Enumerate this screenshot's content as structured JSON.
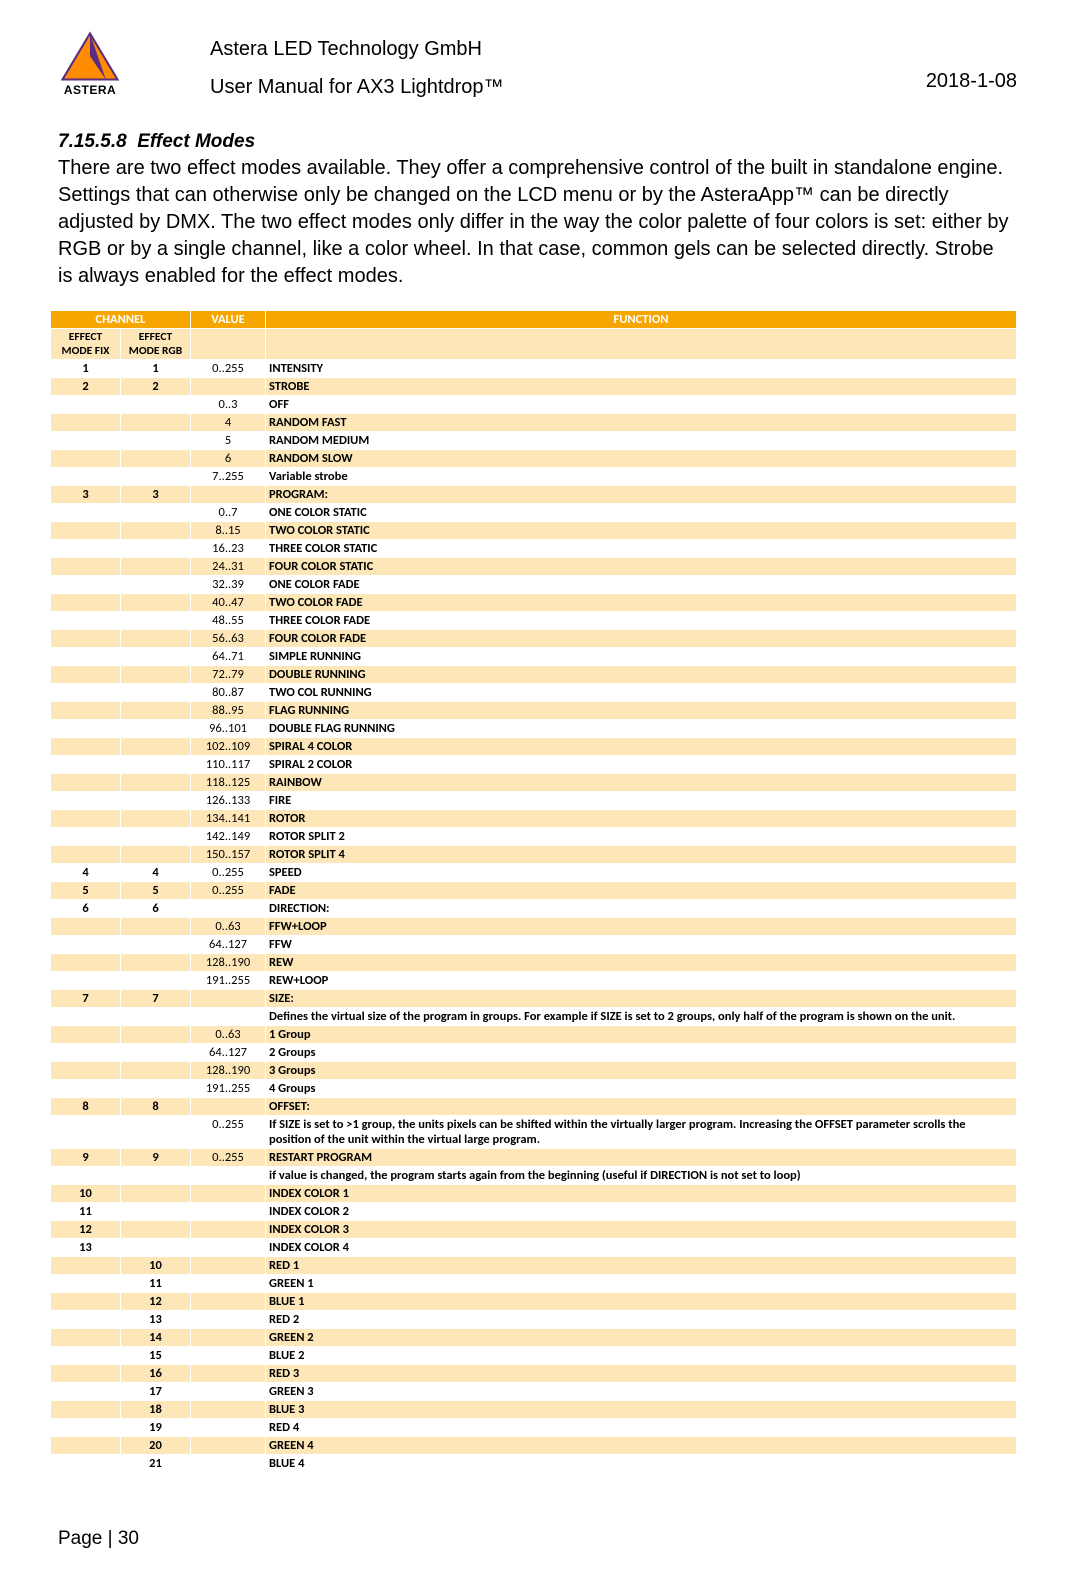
{
  "header": {
    "company": "Astera LED Technology GmbH",
    "product": "User Manual for AX3 Lightdrop™",
    "date": "2018-1-08",
    "logoText": "ASTERA"
  },
  "section": {
    "number": "7.15.5.8",
    "title": "Effect Modes",
    "body": "There are two effect modes available. They offer a comprehensive control of the built in standalone engine. Settings that can otherwise only be changed on the LCD menu or by the AsteraApp™ can be directly adjusted by DMX. The two effect modes only differ in the way the color palette of four colors is set: either by RGB or by a single channel, like a color wheel. In that case, common gels can be selected directly. Strobe is always enabled for the effect modes."
  },
  "table": {
    "headers": {
      "channel": "CHANNEL",
      "value": "VALUE",
      "function": "FUNCTION"
    },
    "subHeaders": {
      "fix": "EFFECT MODE FIX",
      "rgb": "EFFECT MODE RGB"
    },
    "rows": [
      {
        "fix": "1",
        "rgb": "1",
        "val": "0..255",
        "fun": "INTENSITY",
        "bold": true,
        "shade": false,
        "fb": true
      },
      {
        "fix": "2",
        "rgb": "2",
        "val": "",
        "fun": "STROBE",
        "bold": true,
        "shade": true,
        "fb": true
      },
      {
        "fix": "",
        "rgb": "",
        "val": "0..3",
        "fun": "OFF",
        "bold": true,
        "shade": false
      },
      {
        "fix": "",
        "rgb": "",
        "val": "4",
        "fun": "RANDOM FAST",
        "bold": true,
        "shade": true
      },
      {
        "fix": "",
        "rgb": "",
        "val": "5",
        "fun": "RANDOM MEDIUM",
        "bold": true,
        "shade": false
      },
      {
        "fix": "",
        "rgb": "",
        "val": "6",
        "fun": "RANDOM SLOW",
        "bold": true,
        "shade": true
      },
      {
        "fix": "",
        "rgb": "",
        "val": "7..255",
        "fun": "Variable strobe",
        "bold": true,
        "shade": false
      },
      {
        "fix": "3",
        "rgb": "3",
        "val": "",
        "fun": "PROGRAM:",
        "bold": true,
        "shade": true,
        "fb": true
      },
      {
        "fix": "",
        "rgb": "",
        "val": "0..7",
        "fun": "ONE COLOR STATIC",
        "bold": true,
        "shade": false
      },
      {
        "fix": "",
        "rgb": "",
        "val": "8..15",
        "fun": "TWO COLOR STATIC",
        "bold": true,
        "shade": true
      },
      {
        "fix": "",
        "rgb": "",
        "val": "16..23",
        "fun": "THREE COLOR STATIC",
        "bold": true,
        "shade": false
      },
      {
        "fix": "",
        "rgb": "",
        "val": "24..31",
        "fun": "FOUR COLOR STATIC",
        "bold": true,
        "shade": true
      },
      {
        "fix": "",
        "rgb": "",
        "val": "32..39",
        "fun": "ONE COLOR FADE",
        "bold": true,
        "shade": false
      },
      {
        "fix": "",
        "rgb": "",
        "val": "40..47",
        "fun": "TWO COLOR FADE",
        "bold": true,
        "shade": true
      },
      {
        "fix": "",
        "rgb": "",
        "val": "48..55",
        "fun": "THREE COLOR FADE",
        "bold": true,
        "shade": false
      },
      {
        "fix": "",
        "rgb": "",
        "val": "56..63",
        "fun": "FOUR COLOR FADE",
        "bold": true,
        "shade": true
      },
      {
        "fix": "",
        "rgb": "",
        "val": "64..71",
        "fun": "SIMPLE RUNNING",
        "bold": true,
        "shade": false
      },
      {
        "fix": "",
        "rgb": "",
        "val": "72..79",
        "fun": "DOUBLE RUNNING",
        "bold": true,
        "shade": true
      },
      {
        "fix": "",
        "rgb": "",
        "val": "80..87",
        "fun": "TWO COL RUNNING",
        "bold": true,
        "shade": false
      },
      {
        "fix": "",
        "rgb": "",
        "val": "88..95",
        "fun": "FLAG RUNNING",
        "bold": true,
        "shade": true
      },
      {
        "fix": "",
        "rgb": "",
        "val": "96..101",
        "fun": "DOUBLE FLAG RUNNING",
        "bold": true,
        "shade": false
      },
      {
        "fix": "",
        "rgb": "",
        "val": "102..109",
        "fun": "SPIRAL 4 COLOR",
        "bold": true,
        "shade": true
      },
      {
        "fix": "",
        "rgb": "",
        "val": "110..117",
        "fun": "SPIRAL 2 COLOR",
        "bold": true,
        "shade": false
      },
      {
        "fix": "",
        "rgb": "",
        "val": "118..125",
        "fun": "RAINBOW",
        "bold": true,
        "shade": true
      },
      {
        "fix": "",
        "rgb": "",
        "val": "126..133",
        "fun": "FIRE",
        "bold": true,
        "shade": false
      },
      {
        "fix": "",
        "rgb": "",
        "val": "134..141",
        "fun": "ROTOR",
        "bold": true,
        "shade": true
      },
      {
        "fix": "",
        "rgb": "",
        "val": "142..149",
        "fun": "ROTOR SPLIT 2",
        "bold": true,
        "shade": false
      },
      {
        "fix": "",
        "rgb": "",
        "val": "150..157",
        "fun": "ROTOR SPLIT 4",
        "bold": true,
        "shade": true
      },
      {
        "fix": "4",
        "rgb": "4",
        "val": "0..255",
        "fun": "SPEED",
        "bold": true,
        "shade": false,
        "fb": true
      },
      {
        "fix": "5",
        "rgb": "5",
        "val": "0..255",
        "fun": "FADE",
        "bold": true,
        "shade": true,
        "fb": true
      },
      {
        "fix": "6",
        "rgb": "6",
        "val": "",
        "fun": "DIRECTION:",
        "bold": true,
        "shade": false,
        "fb": true
      },
      {
        "fix": "",
        "rgb": "",
        "val": "0..63",
        "fun": "FFW+LOOP",
        "bold": true,
        "shade": true
      },
      {
        "fix": "",
        "rgb": "",
        "val": "64..127",
        "fun": "FFW",
        "bold": true,
        "shade": false
      },
      {
        "fix": "",
        "rgb": "",
        "val": "128..190",
        "fun": "REW",
        "bold": true,
        "shade": true
      },
      {
        "fix": "",
        "rgb": "",
        "val": "191..255",
        "fun": "REW+LOOP",
        "bold": true,
        "shade": false
      },
      {
        "fix": "7",
        "rgb": "7",
        "val": "",
        "fun": "SIZE:",
        "bold": true,
        "shade": true,
        "fb": true
      },
      {
        "fix": "",
        "rgb": "",
        "val": "",
        "fun": "Defines the virtual size of the program in groups. For example if SIZE is set to 2 groups, only half of the program is shown on the unit.",
        "bold": true,
        "shade": false
      },
      {
        "fix": "",
        "rgb": "",
        "val": "0..63",
        "fun": "1 Group",
        "bold": true,
        "shade": true
      },
      {
        "fix": "",
        "rgb": "",
        "val": "64..127",
        "fun": "2 Groups",
        "bold": true,
        "shade": false
      },
      {
        "fix": "",
        "rgb": "",
        "val": "128..190",
        "fun": "3 Groups",
        "bold": true,
        "shade": true
      },
      {
        "fix": "",
        "rgb": "",
        "val": "191..255",
        "fun": "4 Groups",
        "bold": true,
        "shade": false
      },
      {
        "fix": "8",
        "rgb": "8",
        "val": "",
        "fun": "OFFSET:",
        "bold": true,
        "shade": true,
        "fb": true
      },
      {
        "fix": "",
        "rgb": "",
        "val": "0..255",
        "fun": "If SIZE is set to >1 group, the units pixels can be shifted within the virtually larger program. Increasing the OFFSET parameter scrolls the position of the unit within the virtual large program.",
        "bold": true,
        "shade": false
      },
      {
        "fix": "9",
        "rgb": "9",
        "val": "0..255",
        "fun": "RESTART PROGRAM",
        "bold": true,
        "shade": true,
        "fb": true
      },
      {
        "fix": "",
        "rgb": "",
        "val": "",
        "fun": "if value is changed, the program starts again from the beginning (useful if DIRECTION is not set to loop)",
        "bold": true,
        "shade": false
      },
      {
        "fix": "10",
        "rgb": "",
        "val": "",
        "fun": "INDEX COLOR 1",
        "bold": true,
        "shade": true,
        "fb": true
      },
      {
        "fix": "11",
        "rgb": "",
        "val": "",
        "fun": "INDEX COLOR 2",
        "bold": true,
        "shade": false,
        "fb": true
      },
      {
        "fix": "12",
        "rgb": "",
        "val": "",
        "fun": "INDEX COLOR 3",
        "bold": true,
        "shade": true,
        "fb": true
      },
      {
        "fix": "13",
        "rgb": "",
        "val": "",
        "fun": "INDEX COLOR 4",
        "bold": true,
        "shade": false,
        "fb": true
      },
      {
        "fix": "",
        "rgb": "10",
        "val": "",
        "fun": "RED 1",
        "bold": true,
        "shade": true,
        "fb": true
      },
      {
        "fix": "",
        "rgb": "11",
        "val": "",
        "fun": "GREEN 1",
        "bold": true,
        "shade": false,
        "fb": true
      },
      {
        "fix": "",
        "rgb": "12",
        "val": "",
        "fun": "BLUE 1",
        "bold": true,
        "shade": true,
        "fb": true
      },
      {
        "fix": "",
        "rgb": "13",
        "val": "",
        "fun": "RED 2",
        "bold": true,
        "shade": false,
        "fb": true
      },
      {
        "fix": "",
        "rgb": "14",
        "val": "",
        "fun": "GREEN 2",
        "bold": true,
        "shade": true,
        "fb": true
      },
      {
        "fix": "",
        "rgb": "15",
        "val": "",
        "fun": "BLUE 2",
        "bold": true,
        "shade": false,
        "fb": true
      },
      {
        "fix": "",
        "rgb": "16",
        "val": "",
        "fun": "RED 3",
        "bold": true,
        "shade": true,
        "fb": true
      },
      {
        "fix": "",
        "rgb": "17",
        "val": "",
        "fun": "GREEN 3",
        "bold": true,
        "shade": false,
        "fb": true
      },
      {
        "fix": "",
        "rgb": "18",
        "val": "",
        "fun": "BLUE 3",
        "bold": true,
        "shade": true,
        "fb": true
      },
      {
        "fix": "",
        "rgb": "19",
        "val": "",
        "fun": "RED 4",
        "bold": true,
        "shade": false,
        "fb": true
      },
      {
        "fix": "",
        "rgb": "20",
        "val": "",
        "fun": "GREEN 4",
        "bold": true,
        "shade": true,
        "fb": true
      },
      {
        "fix": "",
        "rgb": "21",
        "val": "",
        "fun": "BLUE 4",
        "bold": true,
        "shade": false,
        "fb": true
      }
    ]
  },
  "footer": "Page | 30"
}
